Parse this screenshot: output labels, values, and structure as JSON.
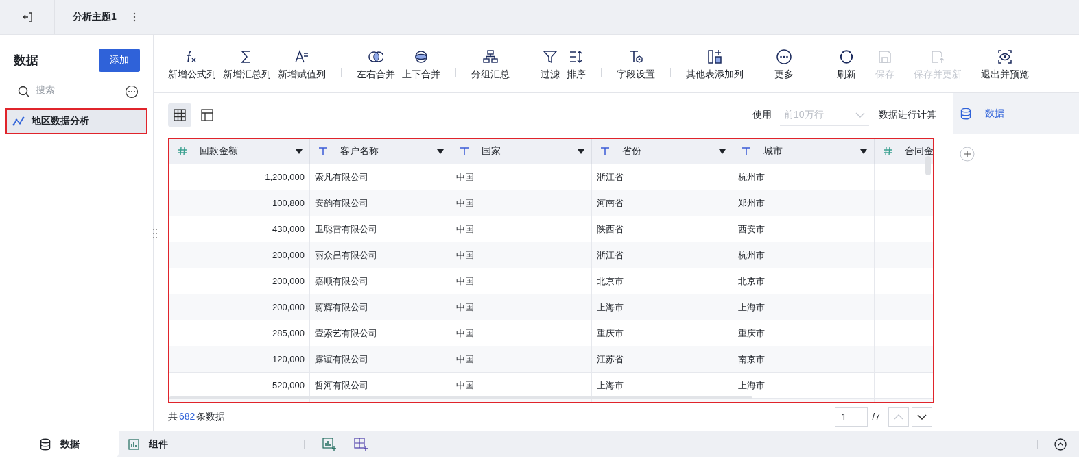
{
  "top_bar": {
    "title": "分析主题1"
  },
  "sidebar": {
    "title": "数据",
    "add_button": "添加",
    "search": {
      "placeholder": "搜索"
    },
    "items": [
      {
        "label": "地区数据分析",
        "selected": true
      }
    ]
  },
  "toolbar": {
    "groups": [
      [
        {
          "label": "新增公式列",
          "disabled": false
        },
        {
          "label": "新增汇总列",
          "disabled": false
        },
        {
          "label": "新增赋值列",
          "disabled": false
        }
      ],
      [
        {
          "label": "左右合并",
          "disabled": false
        },
        {
          "label": "上下合并",
          "disabled": false
        }
      ],
      [
        {
          "label": "分组汇总",
          "disabled": false
        }
      ],
      [
        {
          "label": "过滤",
          "disabled": false
        },
        {
          "label": "排序",
          "disabled": false
        }
      ],
      [
        {
          "label": "字段设置",
          "disabled": false
        }
      ],
      [
        {
          "label": "其他表添加列",
          "disabled": false
        }
      ],
      [
        {
          "label": "更多",
          "disabled": false
        }
      ],
      [
        {
          "label": "刷新",
          "disabled": false
        },
        {
          "label": "保存",
          "disabled": true
        },
        {
          "label": "保存并更新",
          "disabled": true
        },
        {
          "label": "退出并预览",
          "disabled": false
        }
      ]
    ]
  },
  "view_toggles": [
    {
      "kind": "grid",
      "selected": true
    },
    {
      "kind": "layout",
      "selected": false
    }
  ],
  "row_limit": {
    "label": "使用",
    "value": "前10万行",
    "suffix": "数据进行计算"
  },
  "table": {
    "columns": [
      {
        "name": "回款金额",
        "kind": "number"
      },
      {
        "name": "客户名称",
        "kind": "text"
      },
      {
        "name": "国家",
        "kind": "text"
      },
      {
        "name": "省份",
        "kind": "text"
      },
      {
        "name": "城市",
        "kind": "text"
      },
      {
        "name": "合同金",
        "kind": "number"
      }
    ],
    "rows": [
      [
        "1,200,000",
        "索凡有限公司",
        "中国",
        "浙江省",
        "杭州市"
      ],
      [
        "100,800",
        "安韵有限公司",
        "中国",
        "河南省",
        "郑州市"
      ],
      [
        "430,000",
        "卫聪雷有限公司",
        "中国",
        "陕西省",
        "西安市"
      ],
      [
        "200,000",
        "丽众昌有限公司",
        "中国",
        "浙江省",
        "杭州市"
      ],
      [
        "200,000",
        "嘉顺有限公司",
        "中国",
        "北京市",
        "北京市"
      ],
      [
        "200,000",
        "蔚辉有限公司",
        "中国",
        "上海市",
        "上海市"
      ],
      [
        "285,000",
        "壹索艺有限公司",
        "中国",
        "重庆市",
        "重庆市"
      ],
      [
        "120,000",
        "露谊有限公司",
        "中国",
        "江苏省",
        "南京市"
      ],
      [
        "520,000",
        "哲河有限公司",
        "中国",
        "上海市",
        "上海市"
      ]
    ]
  },
  "footer": {
    "prefix": "共",
    "count": "682",
    "suffix": "条数据",
    "page": "1",
    "pages": "/7"
  },
  "right_panel": {
    "items": [
      {
        "label": "数据",
        "selected": true
      }
    ]
  },
  "bottom_bar": {
    "tabs": [
      {
        "label": "数据",
        "selected": true
      },
      {
        "label": "组件",
        "selected": false
      }
    ]
  }
}
